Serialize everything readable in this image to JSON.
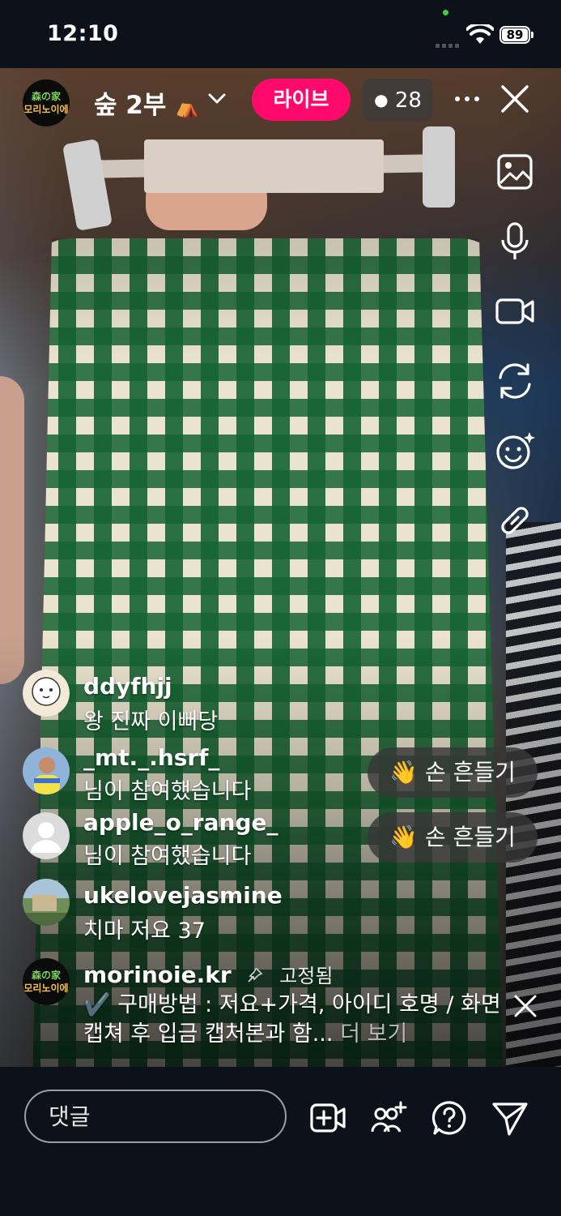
{
  "status_bar": {
    "time": "12:10",
    "battery": "89"
  },
  "live": {
    "host_avatar_line1": "森の家",
    "host_avatar_line2": "모리노이에",
    "title": "숲 2부",
    "title_emoji": "⛺",
    "badge": "라이브",
    "viewer_count": "28"
  },
  "comments": [
    {
      "username": "ddyfhjj",
      "text": "왕 진짜 이뻐당"
    },
    {
      "username": "_mt._.hsrf_",
      "text": "님이 참여했습니다",
      "action": "손 흔들기"
    },
    {
      "username": "apple_o_range_",
      "text": "님이 참여했습니다",
      "action": "손 흔들기"
    },
    {
      "username": "ukelovejasmine",
      "text": "치마 저요 37"
    }
  ],
  "pinned": {
    "username": "morinoie.kr",
    "pinned_label": "고정됨",
    "text": "✔️ 구매방법 : 저요+가격, 아이디 호명 / 화면 캡쳐 후 입금 캡처본과 함...",
    "more": "더 보기"
  },
  "wave_emoji": "👋",
  "input": {
    "placeholder": "댓글"
  },
  "icons": {
    "side": [
      "image-icon",
      "microphone-icon",
      "video-camera-icon",
      "switch-camera-icon",
      "effects-icon",
      "link-icon"
    ],
    "bottom": [
      "add-video-icon",
      "add-guest-icon",
      "question-icon",
      "send-icon"
    ]
  },
  "colors": {
    "live_badge": "#ff0a6c",
    "background": "#0d111a"
  }
}
